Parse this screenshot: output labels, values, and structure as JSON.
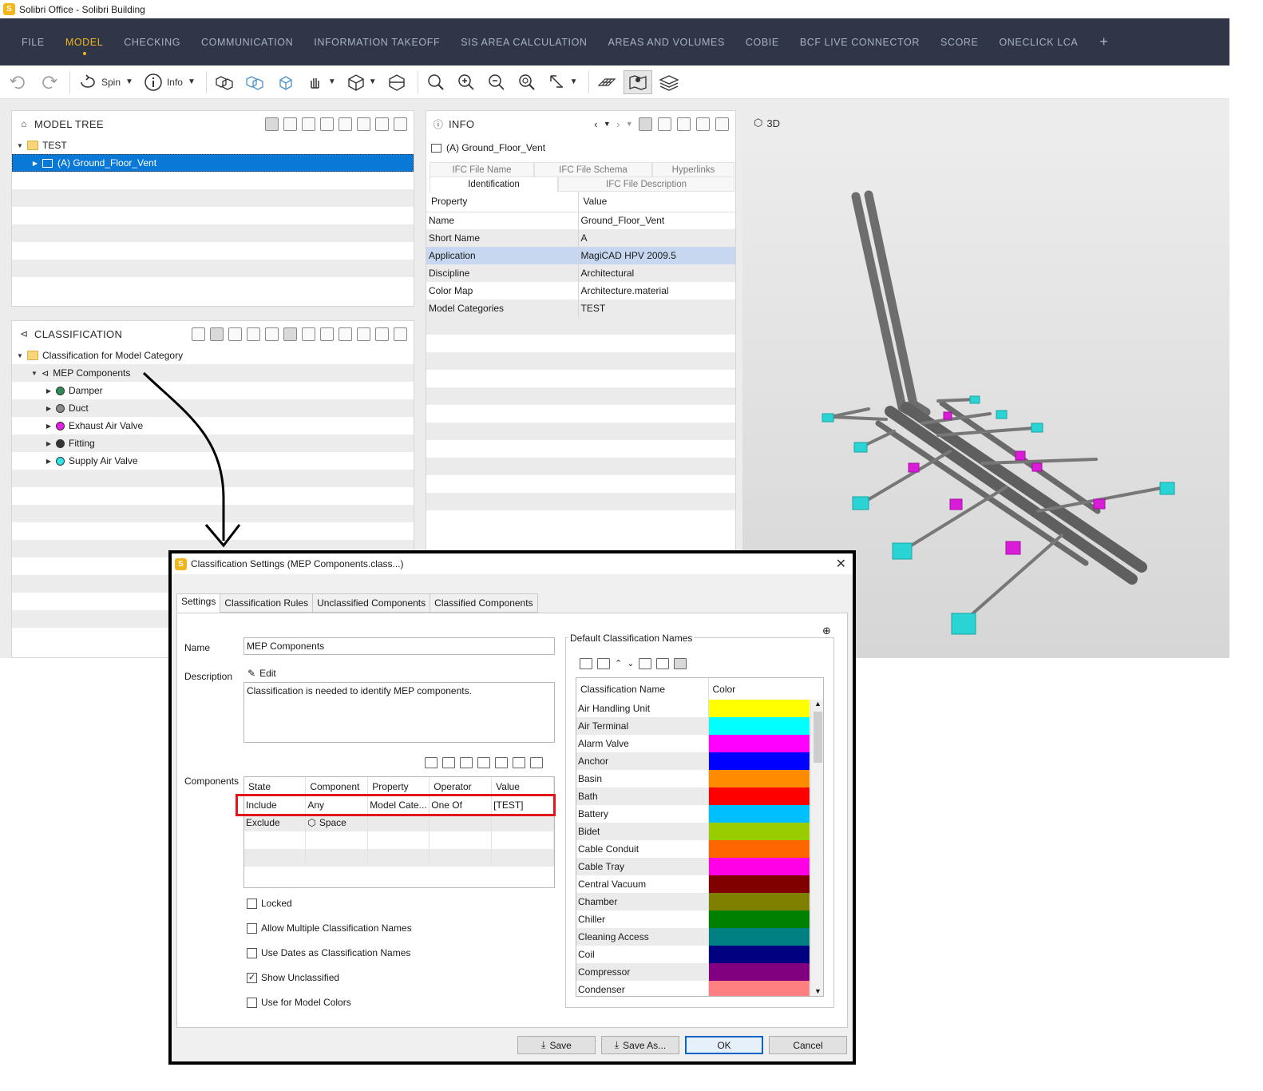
{
  "window": {
    "title": "Solibri Office - Solibri Building",
    "logo_letter": "S"
  },
  "menu": {
    "items": [
      {
        "label": "FILE",
        "active": false
      },
      {
        "label": "MODEL",
        "active": true
      },
      {
        "label": "CHECKING",
        "active": false
      },
      {
        "label": "COMMUNICATION",
        "active": false
      },
      {
        "label": "INFORMATION TAKEOFF",
        "active": false
      },
      {
        "label": "SIS AREA CALCULATION",
        "active": false
      },
      {
        "label": "AREAS AND VOLUMES",
        "active": false
      },
      {
        "label": "COBIE",
        "active": false
      },
      {
        "label": "BCF LIVE CONNECTOR",
        "active": false
      },
      {
        "label": "SCORE",
        "active": false
      },
      {
        "label": "ONECLICK LCA",
        "active": false
      }
    ],
    "add_tab": "+"
  },
  "toolbar": {
    "spin_label": "Spin",
    "info_label": "Info"
  },
  "model_tree": {
    "title": "MODEL TREE",
    "root": "TEST",
    "selected": "(A) Ground_Floor_Vent"
  },
  "classification_panel": {
    "title": "CLASSIFICATION",
    "root": "Classification for Model Category",
    "group": "MEP Components",
    "items": [
      {
        "label": "Damper",
        "color": "#2e8b57"
      },
      {
        "label": "Duct",
        "color": "#8a8a8a"
      },
      {
        "label": "Exhaust Air Valve",
        "color": "#e61ee6"
      },
      {
        "label": "Fitting",
        "color": "#333333"
      },
      {
        "label": "Supply Air Valve",
        "color": "#2ee6e6"
      }
    ]
  },
  "info_panel": {
    "title": "INFO",
    "object": "(A) Ground_Floor_Vent",
    "tabs": {
      "ifc_file_name": "IFC File Name",
      "ifc_file_schema": "IFC File Schema",
      "hyperlinks": "Hyperlinks",
      "identification": "Identification",
      "ifc_file_description": "IFC File Description"
    },
    "header": {
      "property": "Property",
      "value": "Value"
    },
    "rows": [
      {
        "property": "Name",
        "value": "Ground_Floor_Vent"
      },
      {
        "property": "Short Name",
        "value": "A"
      },
      {
        "property": "Application",
        "value": "MagiCAD HPV 2009.5"
      },
      {
        "property": "Discipline",
        "value": "Architectural"
      },
      {
        "property": "Color Map",
        "value": "Architecture.material"
      },
      {
        "property": "Model Categories",
        "value": "TEST"
      }
    ]
  },
  "view3d": {
    "title": "3D"
  },
  "dialog": {
    "title": "Classification Settings (MEP Components.class...)",
    "tabs": [
      "Settings",
      "Classification Rules",
      "Unclassified Components",
      "Classified Components"
    ],
    "name_label": "Name",
    "name_value": "MEP Components",
    "description_label": "Description",
    "edit_label": "Edit",
    "description_text": "Classification is needed to identify MEP components.",
    "components_label": "Components",
    "components_header": {
      "state": "State",
      "component": "Component",
      "property": "Property",
      "operator": "Operator",
      "value": "Value"
    },
    "components_rows": [
      {
        "state": "Include",
        "component": "Any",
        "property": "Model Cate...",
        "operator": "One Of",
        "value": "[TEST]"
      },
      {
        "state": "Exclude",
        "component": "Space",
        "property": "",
        "operator": "",
        "value": ""
      }
    ],
    "checkboxes": [
      {
        "label": "Locked",
        "checked": false
      },
      {
        "label": "Allow Multiple Classification Names",
        "checked": false
      },
      {
        "label": "Use Dates as Classification Names",
        "checked": false
      },
      {
        "label": "Show Unclassified",
        "checked": true
      },
      {
        "label": "Use for Model Colors",
        "checked": false
      }
    ],
    "default_names_title": "Default Classification Names",
    "names_header": {
      "name": "Classification Name",
      "color": "Color"
    },
    "names": [
      {
        "name": "Air Handling Unit",
        "color": "#ffff00"
      },
      {
        "name": "Air Terminal",
        "color": "#00ffff"
      },
      {
        "name": "Alarm Valve",
        "color": "#ff00ff"
      },
      {
        "name": "Anchor",
        "color": "#0000ff"
      },
      {
        "name": "Basin",
        "color": "#ff8c00"
      },
      {
        "name": "Bath",
        "color": "#ff0000"
      },
      {
        "name": "Battery",
        "color": "#00bfff"
      },
      {
        "name": "Bidet",
        "color": "#9acd00"
      },
      {
        "name": "Cable Conduit",
        "color": "#ff6600"
      },
      {
        "name": "Cable Tray",
        "color": "#ff00e6"
      },
      {
        "name": "Central Vacuum",
        "color": "#800000"
      },
      {
        "name": "Chamber",
        "color": "#808000"
      },
      {
        "name": "Chiller",
        "color": "#008000"
      },
      {
        "name": "Cleaning Access",
        "color": "#008080"
      },
      {
        "name": "Coil",
        "color": "#000080"
      },
      {
        "name": "Compressor",
        "color": "#800080"
      },
      {
        "name": "Condenser",
        "color": "#ff8080"
      }
    ],
    "buttons": {
      "save": "Save",
      "save_as": "Save As...",
      "ok": "OK",
      "cancel": "Cancel"
    }
  }
}
